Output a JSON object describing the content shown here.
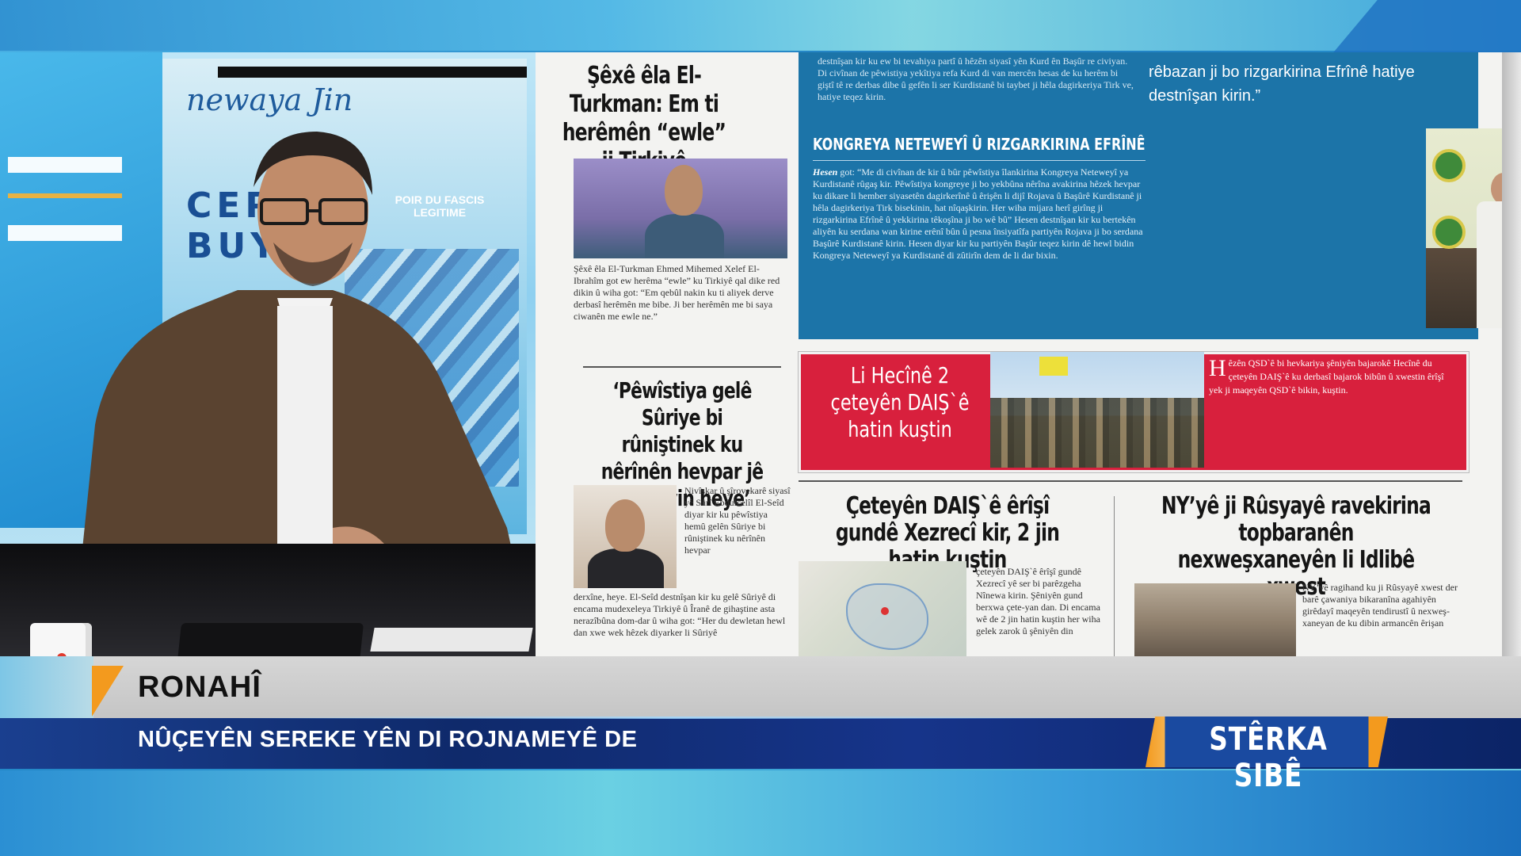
{
  "lower_third": {
    "channel": "RONAHÎ",
    "headline": "NÛÇEYÊN SEREKE YÊN DI ROJNAMEYÊ DE",
    "show_name": "STÊRKA SIBÊ",
    "colors": {
      "accent": "#f39a1e",
      "bar": "#16348a"
    }
  },
  "studio_poster": {
    "logo": "newaya Jin",
    "block_text": [
      "CEPE",
      "BUYU"
    ],
    "sub_text": "POIR DU FASCIS LEGITIME"
  },
  "newspaper": {
    "story1": {
      "headline": "Şêxê êla El-Turkman: Em ti herêmên “ewle” ji Tirkiyê naxwazin",
      "caption": "Şêxê êla El-Turkman Ehmed Mihemed Xelef El-Ibrahîm got ew herêma “ewle” ku Tirkiyê qal dike red dikin û wiha got: “Em qebûl nakin ku ti aliyek derve derbasî herêmên me bibe. Ji ber herêmên me bi saya ciwanên me ewle ne.”"
    },
    "story2": {
      "headline": "‘Pêwîstiya gelê Sûriye bi rûniştinek ku nêrînên hevpar jê derkevin heye’",
      "caption_side": "Nivîskar û şîrovekarê siyasî yê Sûrî Ebdulcelîl El-Seîd diyar kir ku pêwîstiya hemû gelên Sûriye bi rûniştinek ku nêrînên hevpar",
      "caption_bottom": "derxîne, heye. El-Seîd destnîşan kir ku gelê Sûriyê di encama mudexeleya Tirkiyê û Îranê de gihaştine asta nerazîbûna dom-dar û wiha got: “Her du dewletan hewl dan xwe wek hêzek diyarker li Sûriyê"
    },
    "blue_block": {
      "top_text": "destnîşan kir ku ew bi tevahiya partî û hêzên siyasî yên Kurd ên Başûr re civiyan. Di civînan de pêwistiya yekîtiya refa Kurd di van mercên hesas de ku herêm bi giştî tê re derbas dibe û gefên li ser Kurdistanê bi taybet ji hêla dagirkeriya Tirk ve, hatiye teqez kirin.",
      "quote": "rêbazan ji bo rizgarkirina Efrînê hatiye destnîşan kirin.”",
      "title": "KONGREYA NETEWEYÎ Û RIZGARKIRINA EFRÎNÊ",
      "body_lead": "Hesen",
      "body": "got: “Me di civînan de kir û bûr pêwîstiya îlankirina Kongreya Neteweyî ya Kurdistanê rûgaş kir. Pêwîstiya kongreye ji bo yekbûna nêrîna avakirina hêzek hevpar ku dikare li hember siyasetên dagirkerînê û êrişên li dijî Rojava û Başûrê Kurdistanê ji hêla dagirkeriya Tirk bisekinin, hat nîqaşkirin. Her wiha mijara herî girîng ji rizgarkirina Efrînê û yekkirina têkoşîna ji bo wê bû” Hesen destnîşan kir ku bertekên aliyên ku serdana wan kirine erênî bûn û pesna însiyatîfa partiyên Rojava ji bo serdana Başûrê Kurdistanê kirin. Hesen diyar kir ku partiyên Başûr teqez kirin dê hewl bidin Kongreya Neteweyî ya Kurdistanê di zûtirîn dem de li dar bixin."
    },
    "red_banner": {
      "headline": "Li Hecînê 2 çeteyên DAIŞ`ê hatin kuştin",
      "initial": "H",
      "text": "êzên QSD`ê bi hevkariya şêniyên bajarokê Hecînê du çeteyên DAIŞ`ê ku derbasî bajarok bibûn û xwestin êrîşî yek ji maqeyên QSD`ê bikin, kuştin."
    },
    "story3": {
      "headline": "Çeteyên DAIŞ`ê êrîşî gundê Xezrecî kir, 2 jin hatin kuştin",
      "caption": "çeteyên DAIŞ`ê êrîşî gundê Xezrecî yê ser bi parêzgeha Nînewa kirin. Şêniyên gund berxwa çete-yan dan. Di encama wê de 2 jin hatin kuştin her wiha gelek zarok û şêniyên din"
    },
    "story4": {
      "headline": "NY’yê ji Rûsyayê ravekirina topbaranên nexweşxaneyên li Idlibê xwest",
      "caption": "NY’yê ragihand ku ji Rûsyayê xwest der barê çawaniya bikaranîna agahiyên girêdayî maqeyên tendirustî û nexweş-xaneyan de ku dibin armancên êrişan"
    }
  }
}
